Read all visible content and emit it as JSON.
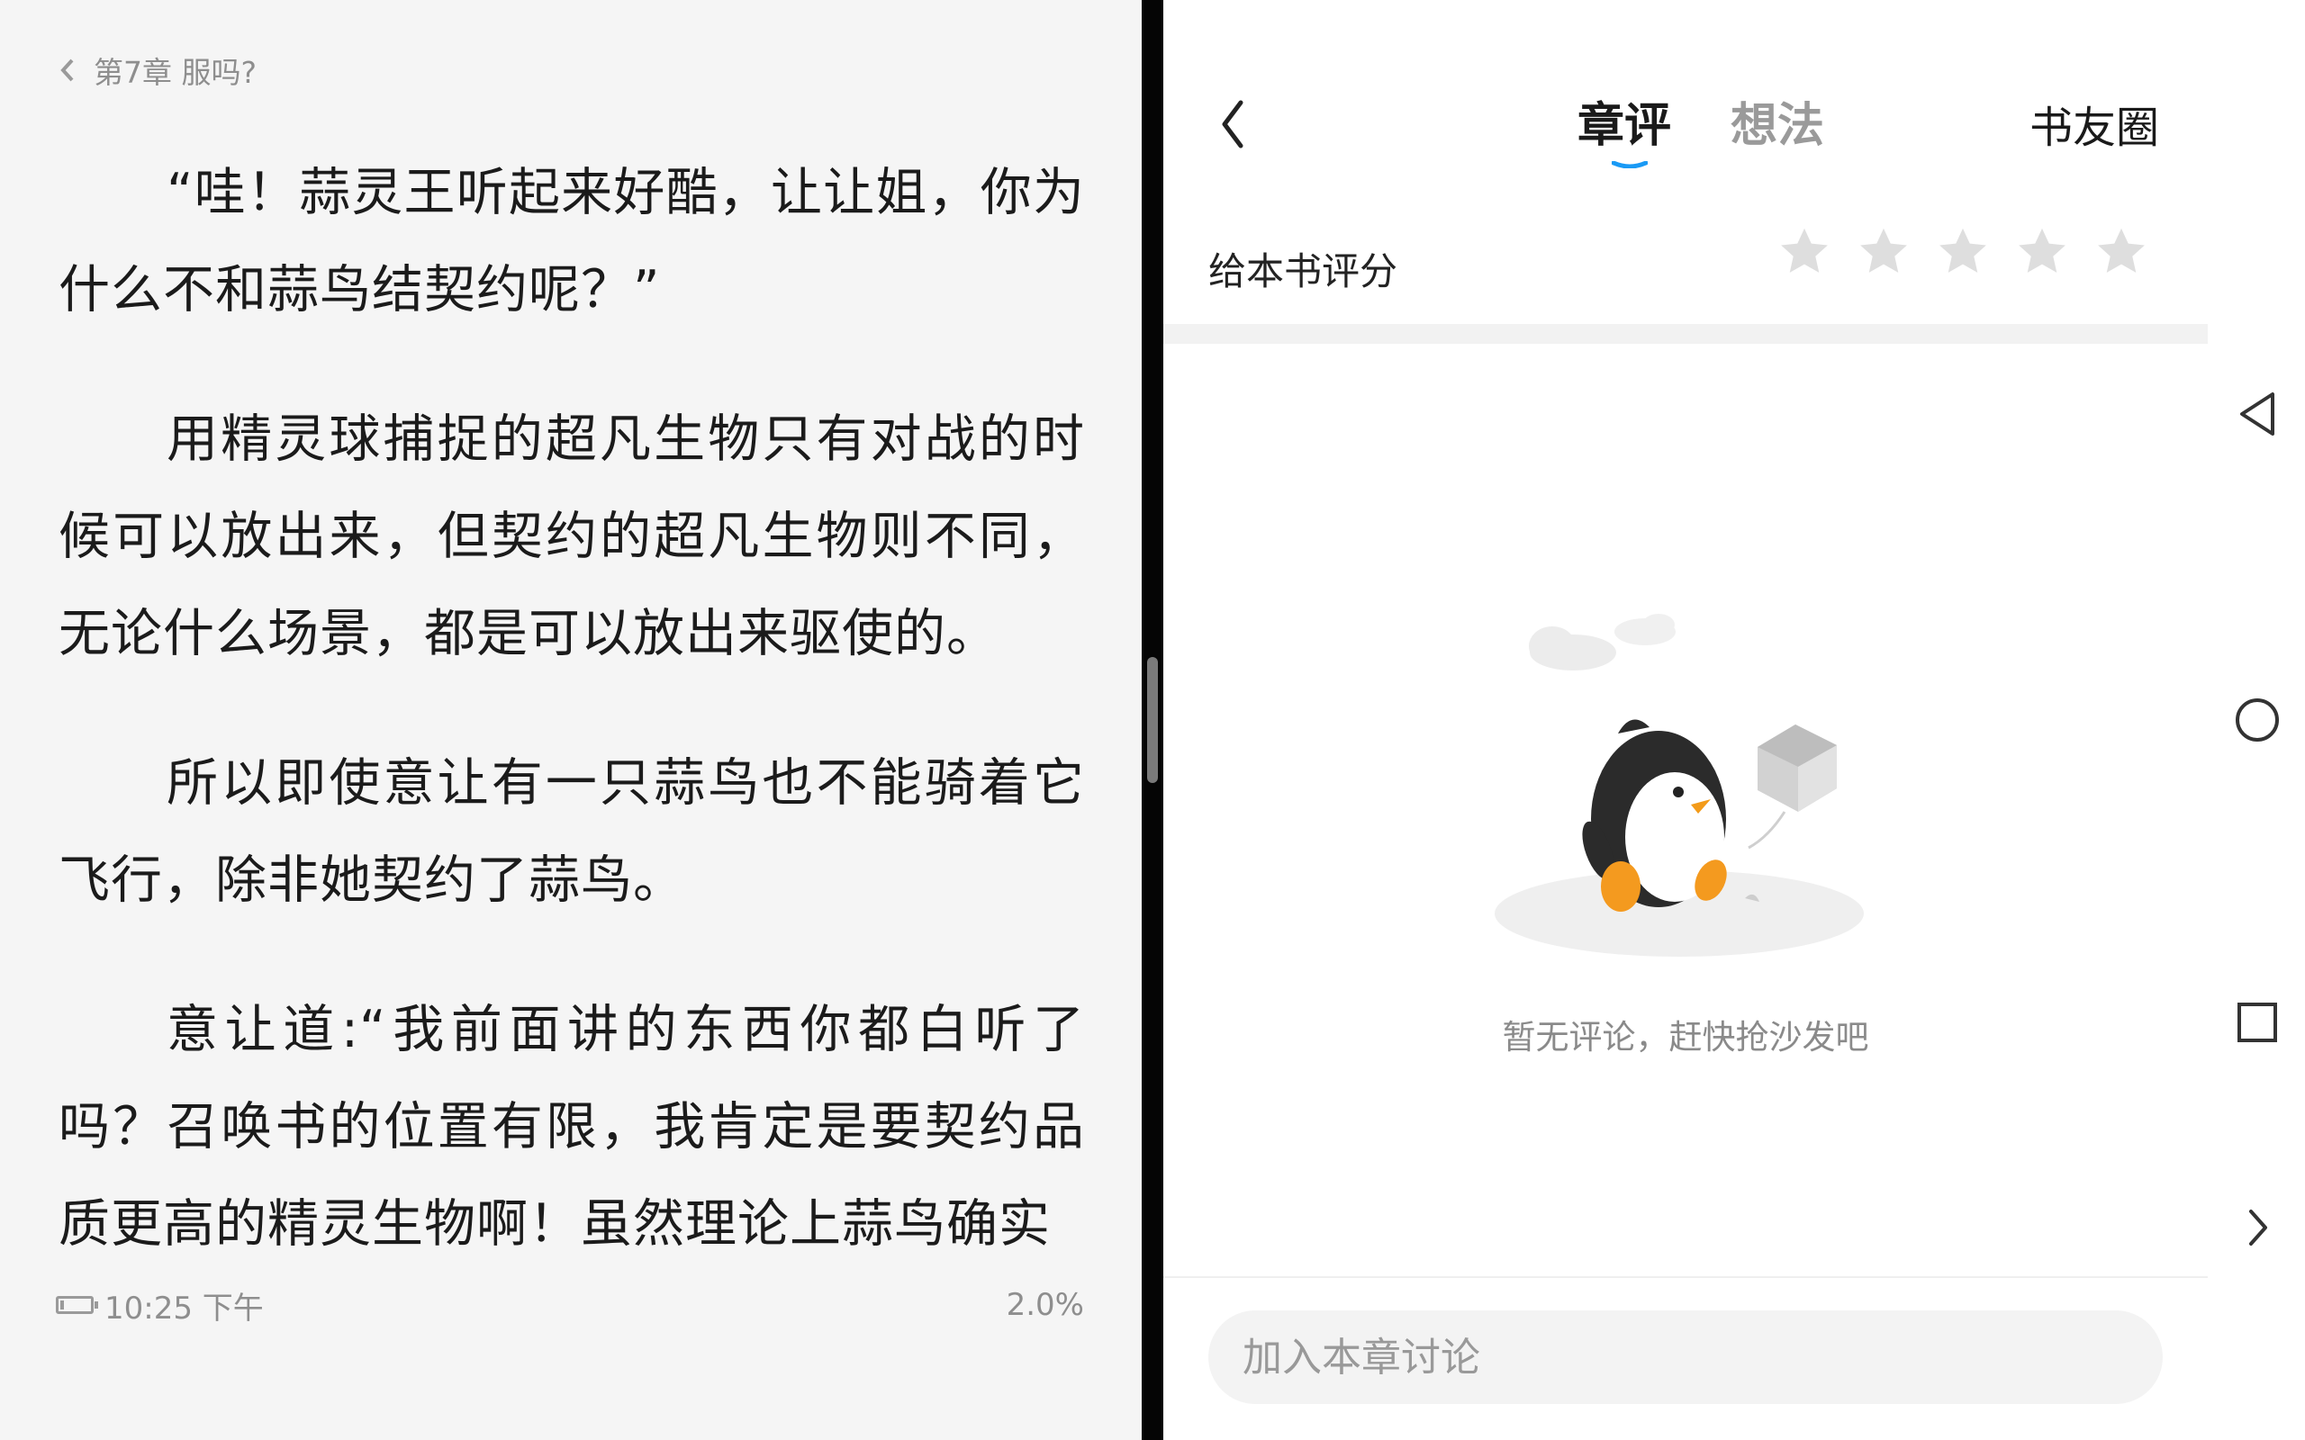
{
  "reader": {
    "chapter_title": "第7章 服吗?",
    "paragraphs": [
      "“哇！蒜灵王听起来好酷，让让姐，你为什么不和蒜鸟结契约呢？”",
      "用精灵球捕捉的超凡生物只有对战的时候可以放出来，但契约的超凡生物则不同，无论什么场景，都是可以放出来驱使的。",
      "所以即使意让有一只蒜鸟也不能骑着它飞行，除非她契约了蒜鸟。",
      "意让道:“我前面讲的东西你都白听了吗？召唤书的位置有限，我肯定是要契约品质更高的精灵生物啊！虽然理论上蒜鸟确实"
    ],
    "time": "10:25 下午",
    "progress": "2.0%"
  },
  "comments_panel": {
    "tabs": [
      {
        "label": "章评",
        "active": true
      },
      {
        "label": "想法",
        "active": false
      }
    ],
    "circle_label": "书友圈",
    "rating_label": "给本书评分",
    "star_count": 5,
    "rating_value": 0,
    "empty_text": "暂无评论，赶快抢沙发吧",
    "input_placeholder": "加入本章讨论",
    "accent_color": "#1a9af5"
  },
  "icons": {
    "back": "chevron-left-icon",
    "chapter": "chevron-left-icon",
    "star": "star-icon",
    "battery": "battery-icon",
    "nav_back": "triangle-back-icon",
    "nav_home": "circle-home-icon",
    "nav_recents": "square-recents-icon",
    "nav_expand": "chevron-right-icon"
  }
}
